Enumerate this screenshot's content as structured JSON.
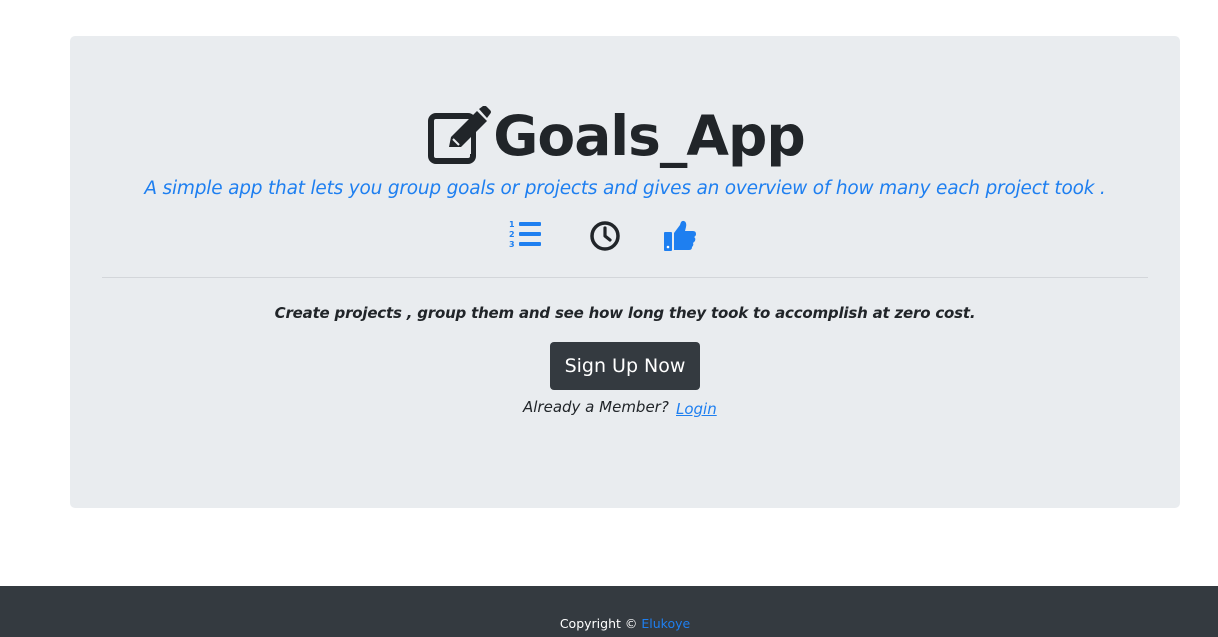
{
  "hero": {
    "title": "Goals_App",
    "title_icon": "edit-icon",
    "lead": "A simple app that lets you group goals or projects and gives an overview of how many each project took .",
    "feature_icons": [
      "ordered-list-icon",
      "clock-icon",
      "thumbs-up-icon"
    ],
    "tagline": "Create projects , group them and see how long they took to accomplish at zero cost.",
    "signup_label": "Sign Up Now",
    "member_text": "Already a Member?",
    "login_label": "Login"
  },
  "footer": {
    "copyright_text": "Copyright ©",
    "author": "Elukoye"
  },
  "colors": {
    "accent": "#1e7ff0",
    "dark": "#343a40",
    "jumbotron_bg": "#e9ecef",
    "text": "#212529"
  }
}
